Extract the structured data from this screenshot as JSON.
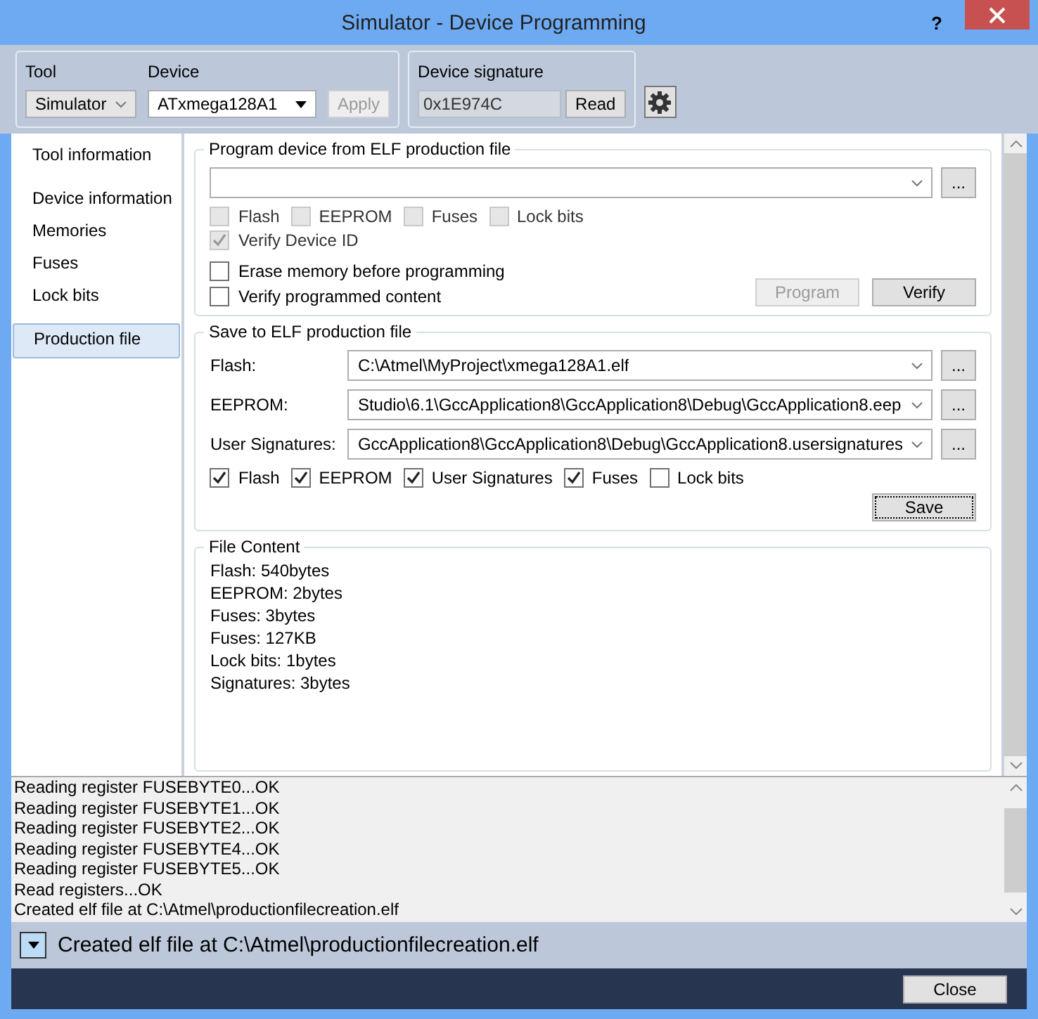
{
  "window": {
    "title": "Simulator - Device Programming",
    "help": "?"
  },
  "toolbar": {
    "tool": {
      "label": "Tool",
      "value": "Simulator"
    },
    "device": {
      "label": "Device",
      "value": "ATxmega128A1"
    },
    "apply": {
      "label": "Apply",
      "disabled": true
    },
    "signature": {
      "label": "Device signature",
      "value": "0x1E974C",
      "read": "Read"
    }
  },
  "sidebar": {
    "items": [
      {
        "label": "Tool information",
        "selected": false
      },
      {
        "label": "Device information",
        "selected": false
      },
      {
        "label": "Memories",
        "selected": false
      },
      {
        "label": "Fuses",
        "selected": false
      },
      {
        "label": "Lock bits",
        "selected": false
      },
      {
        "label": "Production file",
        "selected": true
      }
    ]
  },
  "program_section": {
    "title": "Program device from ELF production file",
    "browse": "...",
    "memory_checkboxes": [
      {
        "label": "Flash",
        "checked": false,
        "disabled": true
      },
      {
        "label": "EEPROM",
        "checked": false,
        "disabled": true
      },
      {
        "label": "Fuses",
        "checked": false,
        "disabled": true
      },
      {
        "label": "Lock bits",
        "checked": false,
        "disabled": true
      }
    ],
    "verify_id": {
      "label": "Verify Device ID",
      "checked": true,
      "disabled": true
    },
    "options": [
      {
        "label": "Erase memory before programming",
        "checked": false,
        "disabled": false
      },
      {
        "label": "Verify programmed content",
        "checked": false,
        "disabled": false
      }
    ],
    "buttons": [
      {
        "label": "Program",
        "disabled": true
      },
      {
        "label": "Verify",
        "disabled": false
      }
    ]
  },
  "save_section": {
    "title": "Save to ELF production file",
    "fields": [
      {
        "label": "Flash:",
        "value": "C:\\Atmel\\MyProject\\xmega128A1.elf",
        "browse": "..."
      },
      {
        "label": "EEPROM:",
        "value": "Studio\\6.1\\GccApplication8\\GccApplication8\\Debug\\GccApplication8.eep",
        "browse": "..."
      },
      {
        "label": "User Signatures:",
        "value": "GccApplication8\\GccApplication8\\Debug\\GccApplication8.usersignatures",
        "browse": "..."
      }
    ],
    "checkboxes": [
      {
        "label": "Flash",
        "checked": true,
        "disabled": false
      },
      {
        "label": "EEPROM",
        "checked": true,
        "disabled": false
      },
      {
        "label": "User Signatures",
        "checked": true,
        "disabled": false
      },
      {
        "label": "Fuses",
        "checked": true,
        "disabled": false
      },
      {
        "label": "Lock bits",
        "checked": false,
        "disabled": false
      }
    ],
    "save": "Save"
  },
  "file_content": {
    "title": "File Content",
    "lines": [
      "Flash: 540bytes",
      "EEPROM: 2bytes",
      "Fuses: 3bytes",
      "Fuses: 127KB",
      "Lock bits: 1bytes",
      "Signatures: 3bytes"
    ]
  },
  "log": {
    "lines": [
      "Reading register FUSEBYTE0...OK",
      "Reading register FUSEBYTE1...OK",
      "Reading register FUSEBYTE2...OK",
      "Reading register FUSEBYTE4...OK",
      "Reading register FUSEBYTE5...OK",
      "Read registers...OK",
      "Created elf file at C:\\Atmel\\productionfilecreation.elf"
    ]
  },
  "status_bar": {
    "text": "Created elf file at C:\\Atmel\\productionfilecreation.elf"
  },
  "footer": {
    "close": "Close"
  }
}
